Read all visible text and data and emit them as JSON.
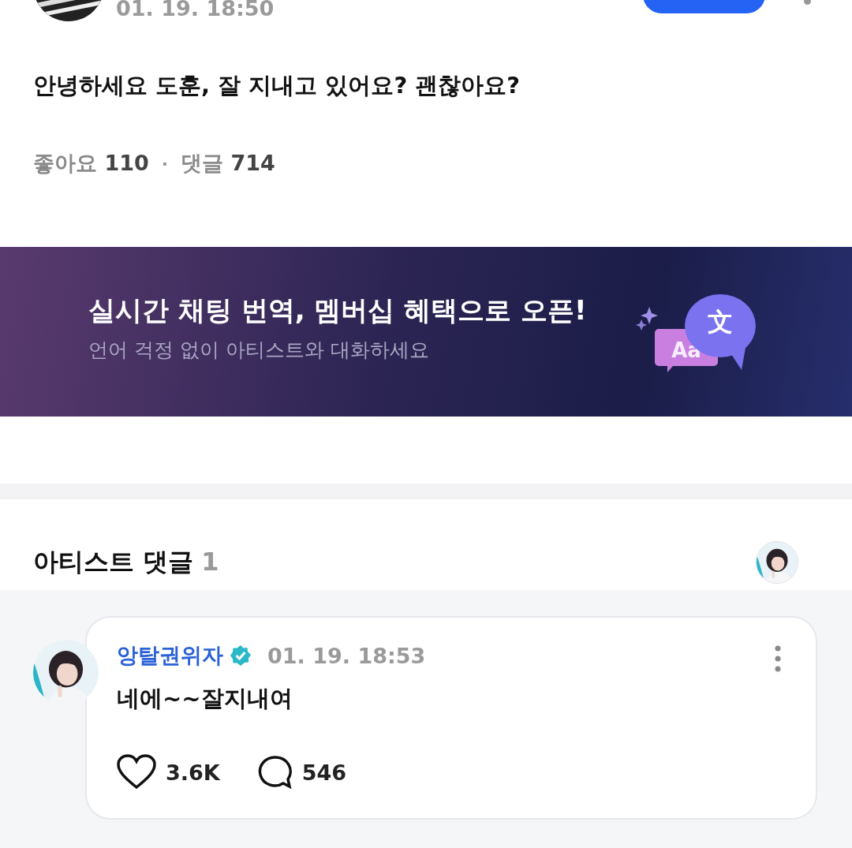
{
  "post": {
    "date": "01. 19. 18:50",
    "text": "안녕하세요 도훈, 잘 지내고 있어요? 괜찮아요?",
    "stats": [
      {
        "label": "좋아요",
        "count": "110"
      },
      {
        "label": "댓글",
        "count": "714"
      }
    ],
    "separator": "·"
  },
  "banner": {
    "title": "실시간 채팅 번역, 멤버십 혜택으로 오픈!",
    "subtitle": "언어 걱정 없이 아티스트와 대화하세요",
    "icon_texts": [
      "Aa",
      "文"
    ]
  },
  "artist_comments": {
    "title": "아티스트 댓글",
    "count": "1",
    "comments": [
      {
        "author": "앙탈권위자",
        "verified": true,
        "date": "01. 19. 18:53",
        "text": "네에~~잘지내여",
        "likes": "3.6K",
        "replies": "546"
      }
    ]
  }
}
